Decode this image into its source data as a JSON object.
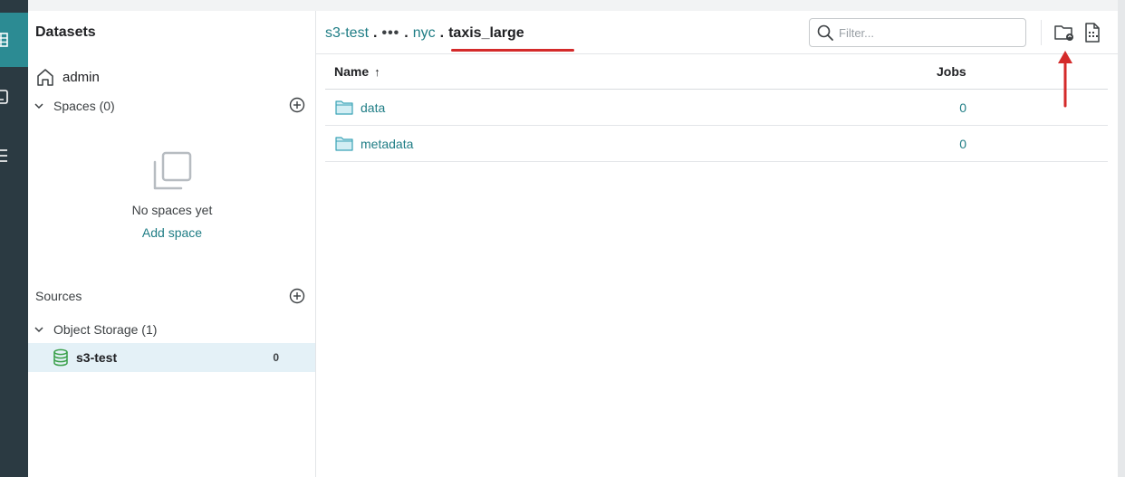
{
  "sidebar": {
    "title": "Datasets",
    "home_label": "admin",
    "spaces": {
      "label": "Spaces (0)",
      "empty_text": "No spaces yet",
      "add_link": "Add space"
    },
    "sources": {
      "label": "Sources",
      "group_label": "Object Storage (1)",
      "items": [
        {
          "label": "s3-test",
          "count": "0"
        }
      ]
    }
  },
  "header": {
    "breadcrumb": {
      "root": "s3-test",
      "sep": ".",
      "ellipsis": "•••",
      "parent": "nyc",
      "current": "taxis_large"
    },
    "filter": {
      "placeholder": "Filter...",
      "value": ""
    },
    "icons": [
      "folder-format-icon",
      "file-format-icon"
    ]
  },
  "table": {
    "columns": {
      "name": "Name",
      "sort_indicator": "↑",
      "jobs": "Jobs"
    },
    "rows": [
      {
        "name": "data",
        "jobs": "0"
      },
      {
        "name": "metadata",
        "jobs": "0"
      }
    ]
  },
  "colors": {
    "accent": "#1f7d85",
    "rail": "#2b3a42",
    "rail_active": "#2c8b93",
    "annotation": "#d42a2a",
    "selected": "#e4f1f7"
  }
}
